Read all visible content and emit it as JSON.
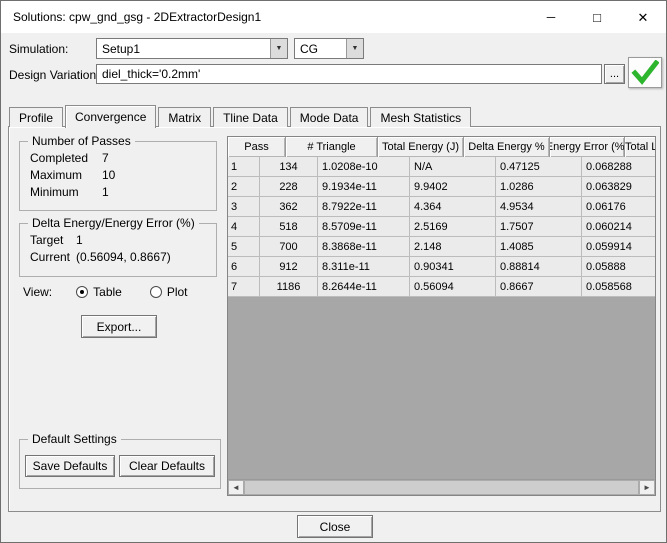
{
  "window": {
    "title": "Solutions: cpw_gnd_gsg - 2DExtractorDesign1"
  },
  "icons": {
    "minimize": "─",
    "maximize": "□",
    "close": "✕",
    "dropdown_arrow": "▼",
    "browse": "...",
    "scroll_left": "◄",
    "scroll_right": "►"
  },
  "colors": {
    "check_green": "#2db52d"
  },
  "simulation": {
    "label": "Simulation:",
    "setup_value": "Setup1",
    "type_value": "CG"
  },
  "design_variation": {
    "label": "Design Variation:",
    "value": "diel_thick='0.2mm'"
  },
  "tabs": [
    "Profile",
    "Convergence",
    "Matrix",
    "Tline Data",
    "Mode Data",
    "Mesh Statistics"
  ],
  "passes_group": {
    "title": "Number of Passes",
    "rows": [
      {
        "label": "Completed",
        "value": "7"
      },
      {
        "label": "Maximum",
        "value": "10"
      },
      {
        "label": "Minimum",
        "value": "1"
      }
    ]
  },
  "delta_group": {
    "title": "Delta Energy/Energy Error (%)",
    "rows": [
      {
        "label": "Target",
        "value": "1"
      },
      {
        "label": "Current",
        "value": "(0.56094, 0.8667)"
      }
    ]
  },
  "view": {
    "label": "View:",
    "options": [
      {
        "label": "Table",
        "selected": true
      },
      {
        "label": "Plot",
        "selected": false
      }
    ]
  },
  "default_settings": {
    "title": "Default Settings"
  },
  "buttons": {
    "export": "Export...",
    "save_defaults": "Save Defaults",
    "clear_defaults": "Clear Defaults",
    "close": "Close"
  },
  "table": {
    "columns": [
      "Pass",
      "# Triangle",
      "Total Energy (J)",
      "Delta Energy %",
      "Energy Error (%)",
      "Total Loss (W)"
    ],
    "rows": [
      [
        "1",
        "134",
        "1.0208e-10",
        "N/A",
        "0.47125",
        "0.068288"
      ],
      [
        "2",
        "228",
        "9.1934e-11",
        "9.9402",
        "1.0286",
        "0.063829"
      ],
      [
        "3",
        "362",
        "8.7922e-11",
        "4.364",
        "4.9534",
        "0.06176"
      ],
      [
        "4",
        "518",
        "8.5709e-11",
        "2.5169",
        "1.7507",
        "0.060214"
      ],
      [
        "5",
        "700",
        "8.3868e-11",
        "2.148",
        "1.4085",
        "0.059914"
      ],
      [
        "6",
        "912",
        "8.311e-11",
        "0.90341",
        "0.88814",
        "0.05888"
      ],
      [
        "7",
        "1186",
        "8.2644e-11",
        "0.56094",
        "0.8667",
        "0.058568"
      ]
    ]
  }
}
